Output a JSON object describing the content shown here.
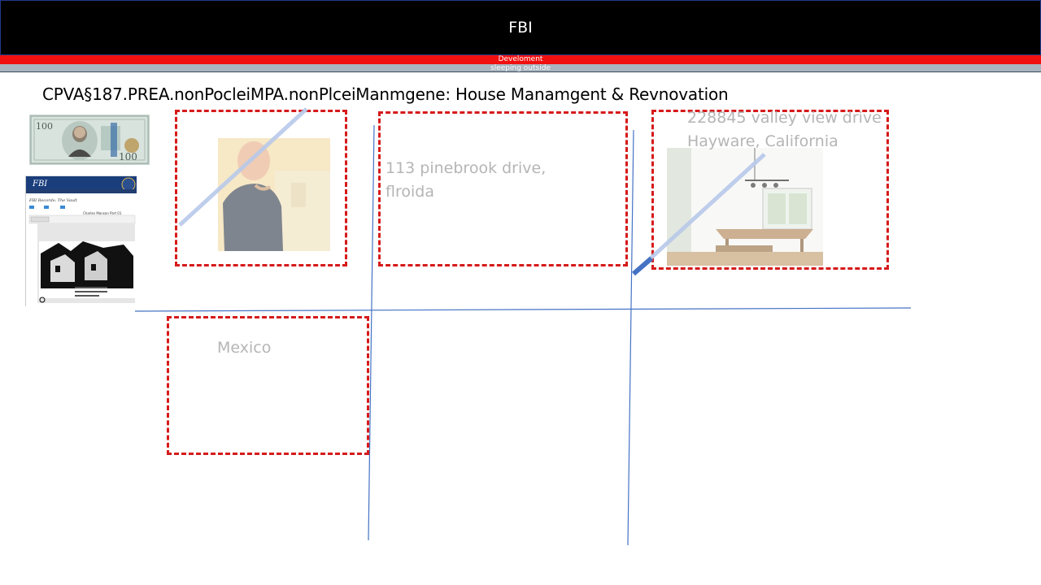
{
  "header": {
    "title": "FBI",
    "red_bar_text": "Develoment",
    "gray_bar_text": "sleeping outside"
  },
  "heading": "CPVA§187.PREA.nonPocleiMPA.nonPlceiManmgene: House Manamgent & Revnovation",
  "boxes": {
    "pinebrook": {
      "line1": "113 pinebrook drive,",
      "line2": "flroida"
    },
    "valley_view": {
      "line1": "228845 valley view drive",
      "line2": "Hayware, California"
    },
    "mexico": {
      "label": "Mexico"
    }
  },
  "thumbnails": {
    "banknote": {
      "denomination": "100"
    },
    "fbi_vault": {
      "banner_text": "FBI",
      "page_title": "FBI Records: The Vault",
      "doc_title": "Charles Manson Part 01"
    }
  },
  "colors": {
    "box_border": "#d61a1a",
    "grid_line": "#4472c4",
    "top_bar": "#000000",
    "red_bar": "#f01010",
    "gray_bar": "#a9b4bf",
    "placeholder_text": "#b5b5b5"
  }
}
